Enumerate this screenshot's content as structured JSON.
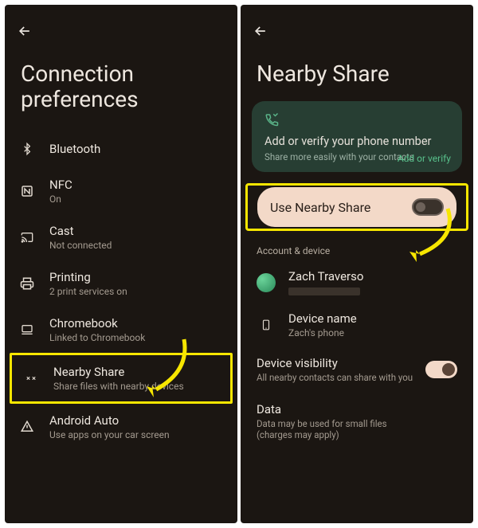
{
  "left": {
    "title": "Connection preferences",
    "items": [
      {
        "label": "Bluetooth",
        "sub": ""
      },
      {
        "label": "NFC",
        "sub": "On"
      },
      {
        "label": "Cast",
        "sub": "Not connected"
      },
      {
        "label": "Printing",
        "sub": "2 print services on"
      },
      {
        "label": "Chromebook",
        "sub": "Linked to Chromebook"
      },
      {
        "label": "Nearby Share",
        "sub": "Share files with nearby devices"
      },
      {
        "label": "Android Auto",
        "sub": "Use apps on your car screen"
      }
    ]
  },
  "right": {
    "title": "Nearby Share",
    "promo": {
      "title": "Add or verify your phone number",
      "sub": "Share more easily with your contacts",
      "link": "Add or verify"
    },
    "toggle": {
      "label": "Use Nearby Share",
      "on": false
    },
    "section": "Account & device",
    "account": {
      "name": "Zach Traverso"
    },
    "device": {
      "label": "Device name",
      "value": "Zach's phone"
    },
    "visibility": {
      "label": "Device visibility",
      "sub": "All nearby contacts can share with you",
      "on": true
    },
    "data": {
      "label": "Data",
      "sub": "Data may be used for small files (charges may apply)"
    }
  },
  "annotations": {
    "arrow_color": "#f7e600"
  }
}
